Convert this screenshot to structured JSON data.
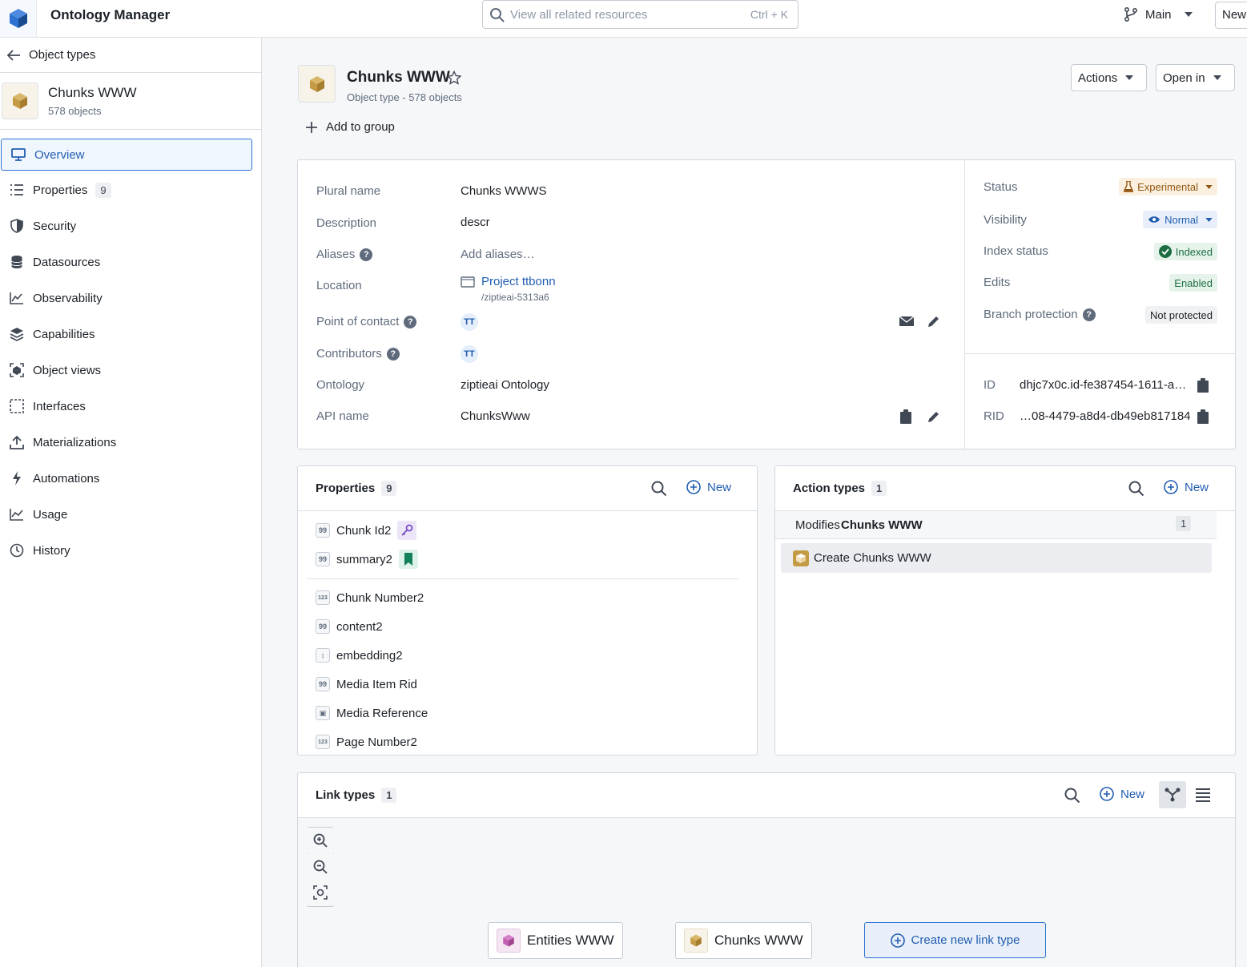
{
  "app": {
    "title": "Ontology Manager"
  },
  "search": {
    "placeholder": "View all related resources",
    "shortcut": "Ctrl + K"
  },
  "branch": {
    "label": "Main"
  },
  "top_new": "New",
  "sidebar": {
    "back_label": "Object types",
    "object": {
      "name": "Chunks WWW",
      "count": "578 objects"
    },
    "items": [
      {
        "label": "Overview",
        "icon": "monitor-icon",
        "active": true
      },
      {
        "label": "Properties",
        "icon": "list-icon",
        "badge": "9"
      },
      {
        "label": "Security",
        "icon": "shield-icon"
      },
      {
        "label": "Datasources",
        "icon": "database-icon"
      },
      {
        "label": "Observability",
        "icon": "chart-area-icon"
      },
      {
        "label": "Capabilities",
        "icon": "layers-icon"
      },
      {
        "label": "Object views",
        "icon": "object-view-icon"
      },
      {
        "label": "Interfaces",
        "icon": "dashed-square-icon"
      },
      {
        "label": "Materializations",
        "icon": "upload-icon"
      },
      {
        "label": "Automations",
        "icon": "lightning-icon"
      },
      {
        "label": "Usage",
        "icon": "line-chart-icon"
      },
      {
        "label": "History",
        "icon": "clock-icon"
      }
    ]
  },
  "header": {
    "title": "Chunks WWW",
    "subtitle": "Object type - 578 objects",
    "actions_label": "Actions",
    "open_in_label": "Open in",
    "add_group_label": "Add to group"
  },
  "metadata": {
    "plural_name": {
      "label": "Plural name",
      "value": "Chunks WWWS"
    },
    "description": {
      "label": "Description",
      "value": "descr"
    },
    "aliases": {
      "label": "Aliases",
      "value": "Add aliases…"
    },
    "location": {
      "label": "Location",
      "value": "Project ttbonn",
      "path": "/ziptieai-5313a6"
    },
    "point_of_contact": {
      "label": "Point of contact",
      "value": "TT"
    },
    "contributors": {
      "label": "Contributors",
      "value": "TT"
    },
    "ontology": {
      "label": "Ontology",
      "value": "ziptieai Ontology"
    },
    "api_name": {
      "label": "API name",
      "value": "ChunksWww"
    }
  },
  "status": {
    "status": {
      "label": "Status",
      "value": "Experimental",
      "color": "#935610"
    },
    "visibility": {
      "label": "Visibility",
      "value": "Normal",
      "color": "#215db0"
    },
    "index_status": {
      "label": "Index status",
      "value": "Indexed",
      "color": "#1c6e42"
    },
    "edits": {
      "label": "Edits",
      "value": "Enabled",
      "color": "#1c6e42"
    },
    "branch_protection": {
      "label": "Branch protection",
      "value": "Not protected"
    },
    "id": {
      "label": "ID",
      "value": "dhjc7x0c.id-fe387454-1611-a…"
    },
    "rid": {
      "label": "RID",
      "value": "…08-4479-a8d4-db49eb817184"
    }
  },
  "properties_panel": {
    "title": "Properties",
    "count": "9",
    "new_label": "New",
    "primary": [
      {
        "name": "Chunk Id2",
        "type_icon": "string-icon",
        "badge": "key-icon"
      },
      {
        "name": "summary2",
        "type_icon": "string-icon",
        "badge": "bookmark-icon"
      }
    ],
    "others": [
      {
        "name": "Chunk Number2",
        "type_icon": "number-icon",
        "glyph": "123"
      },
      {
        "name": "content2",
        "type_icon": "string-icon",
        "glyph": "99"
      },
      {
        "name": "embedding2",
        "type_icon": "vector-icon",
        "glyph": "↕"
      },
      {
        "name": "Media Item Rid",
        "type_icon": "string-icon",
        "glyph": "99"
      },
      {
        "name": "Media Reference",
        "type_icon": "media-icon",
        "glyph": "▣"
      },
      {
        "name": "Page Number2",
        "type_icon": "number-icon",
        "glyph": "123"
      }
    ]
  },
  "action_types_panel": {
    "title": "Action types",
    "count": "1",
    "new_label": "New",
    "group_prefix": "Modifies",
    "group_object": "Chunks WWW",
    "group_count": "1",
    "items": [
      {
        "name": "Create Chunks WWW"
      }
    ]
  },
  "link_types_panel": {
    "title": "Link types",
    "count": "1",
    "new_label": "New",
    "nodes": [
      {
        "name": "Entities WWW"
      },
      {
        "name": "Chunks WWW"
      }
    ],
    "create_label": "Create new link type"
  }
}
